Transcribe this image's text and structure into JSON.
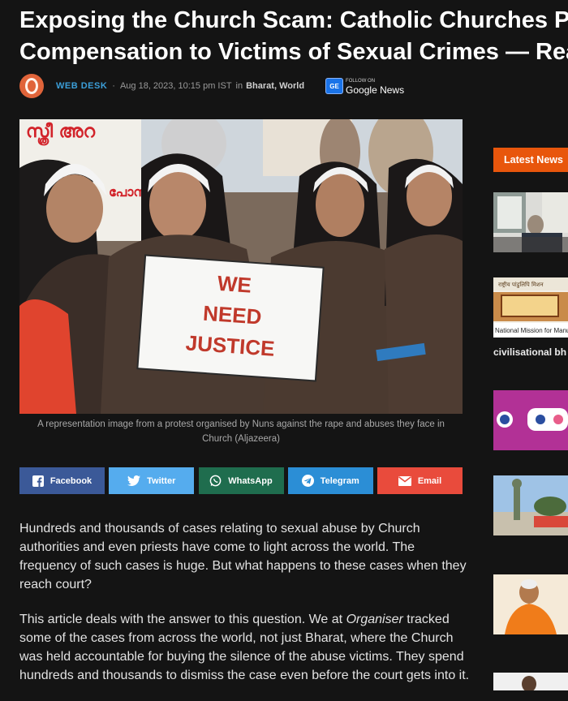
{
  "article": {
    "title_line1": "Exposing the Church Scam: Catholic Churches Pay",
    "title_line2": "Compensation to Victims of Sexual Crimes — Read De",
    "author": "WEB DESK",
    "separator": "·",
    "date": "Aug 18, 2023, 10:15 pm IST",
    "in_word": "in",
    "categories": [
      "Bharat",
      "World"
    ],
    "google_news": {
      "follow_label": "FOLLOW ON",
      "label": "Google News",
      "badge": "GE"
    },
    "image": {
      "sign_line1": "WE",
      "sign_line2": "NEED",
      "sign_line3": "JUSTICE",
      "banner_text": "സ്ത്രീ അറ",
      "banner_text2": "പോസ്"
    },
    "caption_line1": "A representation image from a protest organised by Nuns against the rape and abuses they face in",
    "caption_line2": "Church (Aljazeera)",
    "paragraph1": "Hundreds and thousands of cases relating to sexual abuse by Church authorities and even priests have come to light across the world. The frequency of such cases is huge. But what happens to these cases when they reach court?",
    "paragraph2_before": "This article deals with the answer to this question. We at ",
    "paragraph2_em": "Organiser",
    "paragraph2_after": " tracked some of the cases from across the world, not just Bharat, where the Church was held accountable for buying the silence of the abuse victims. They spend hundreds and thousands to dismiss the case even before the court gets into it."
  },
  "share": {
    "facebook": "Facebook",
    "twitter": "Twitter",
    "whatsapp": "WhatsApp",
    "telegram": "Telegram",
    "email": "Email",
    "colors": {
      "facebook": "#3b5998",
      "twitter": "#55acee",
      "whatsapp": "#1f6d4e",
      "telegram": "#2b8ed6",
      "email": "#e94b3c"
    }
  },
  "sidebar": {
    "heading": "Latest News",
    "caption": "civilisational bh",
    "thumb2_text": "National Mission for Manusc",
    "thumb2_hindi": "राष्ट्रीय पांडुलिपि मिशन"
  },
  "colors": {
    "accent": "#e8560c",
    "link": "#3b9ed8",
    "background": "#141414"
  }
}
